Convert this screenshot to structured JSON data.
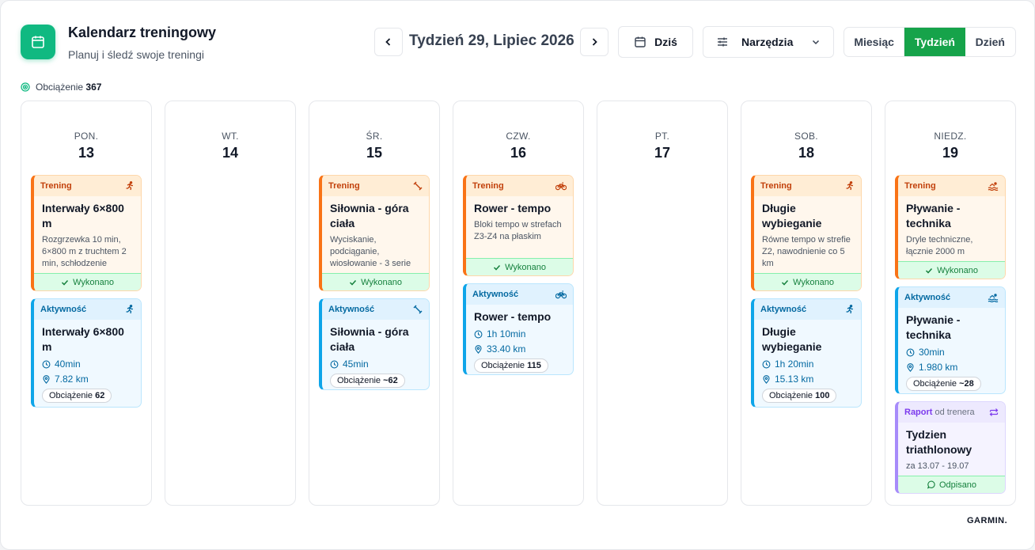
{
  "app": {
    "title": "Kalendarz treningowy",
    "subtitle": "Planuj i śledź swoje treningi",
    "icon": "calendar-icon"
  },
  "nav": {
    "week_title": "Tydzień 29, Lipiec 2026",
    "today_label": "Dziś",
    "tools_label": "Narzędzia"
  },
  "views": {
    "month": "Miesiąc",
    "week": "Tydzień",
    "day": "Dzień",
    "active": "week"
  },
  "load": {
    "label": "Obciążenie",
    "value": "367"
  },
  "colors": {
    "accent": "#16a34a",
    "training": "#f97316",
    "activity": "#0ea5e9",
    "report": "#a78bfa",
    "done": "#15803d"
  },
  "labels": {
    "training": "Trening",
    "activity": "Aktywność",
    "report": "Raport",
    "from_coach": "od trenera",
    "done": "Wykonano",
    "answered": "Odpisano",
    "load": "Obciążenie"
  },
  "days": [
    {
      "name": "PON.",
      "num": "13",
      "training": {
        "title": "Interwały 6×800 m",
        "desc": "Rozgrzewka 10 min, 6×800 m z truchtem 2 min, schłodzenie",
        "icon": "run-icon"
      },
      "activity": {
        "title": "Interwały 6×800 m",
        "time": "40min",
        "distance": "7.82 km",
        "load": "62",
        "icon": "run-icon"
      }
    },
    {
      "name": "WT.",
      "num": "14"
    },
    {
      "name": "ŚR.",
      "num": "15",
      "training": {
        "title": "Siłownia - góra ciała",
        "desc": "Wyciskanie, podciąganie, wiosłowanie - 3 serie",
        "icon": "strength-icon"
      },
      "activity": {
        "title": "Siłownia - góra ciała",
        "time": "45min",
        "load": "~62",
        "icon": "strength-icon"
      }
    },
    {
      "name": "CZW.",
      "num": "16",
      "training": {
        "title": "Rower - tempo",
        "desc": "Bloki tempo w strefach Z3-Z4 na płaskim",
        "icon": "bike-icon"
      },
      "activity": {
        "title": "Rower - tempo",
        "time": "1h 10min",
        "distance": "33.40 km",
        "load": "115",
        "icon": "bike-icon"
      }
    },
    {
      "name": "PT.",
      "num": "17"
    },
    {
      "name": "SOB.",
      "num": "18",
      "training": {
        "title": "Długie wybieganie",
        "desc": "Równe tempo w strefie Z2, nawodnienie co 5 km",
        "icon": "run-icon"
      },
      "activity": {
        "title": "Długie wybieganie",
        "time": "1h 20min",
        "distance": "15.13 km",
        "load": "100",
        "icon": "run-icon"
      }
    },
    {
      "name": "NIEDZ.",
      "num": "19",
      "training": {
        "title": "Pływanie - technika",
        "desc": "Dryle techniczne, łącznie 2000 m",
        "icon": "swim-icon"
      },
      "activity": {
        "title": "Pływanie - technika",
        "time": "30min",
        "distance": "1.980 km",
        "load": "~28",
        "icon": "swim-icon"
      },
      "report": {
        "title": "Tydzien triathlonowy",
        "range": "za 13.07 - 19.07",
        "icon": "repeat-icon"
      }
    }
  ],
  "brand": "GARMIN."
}
